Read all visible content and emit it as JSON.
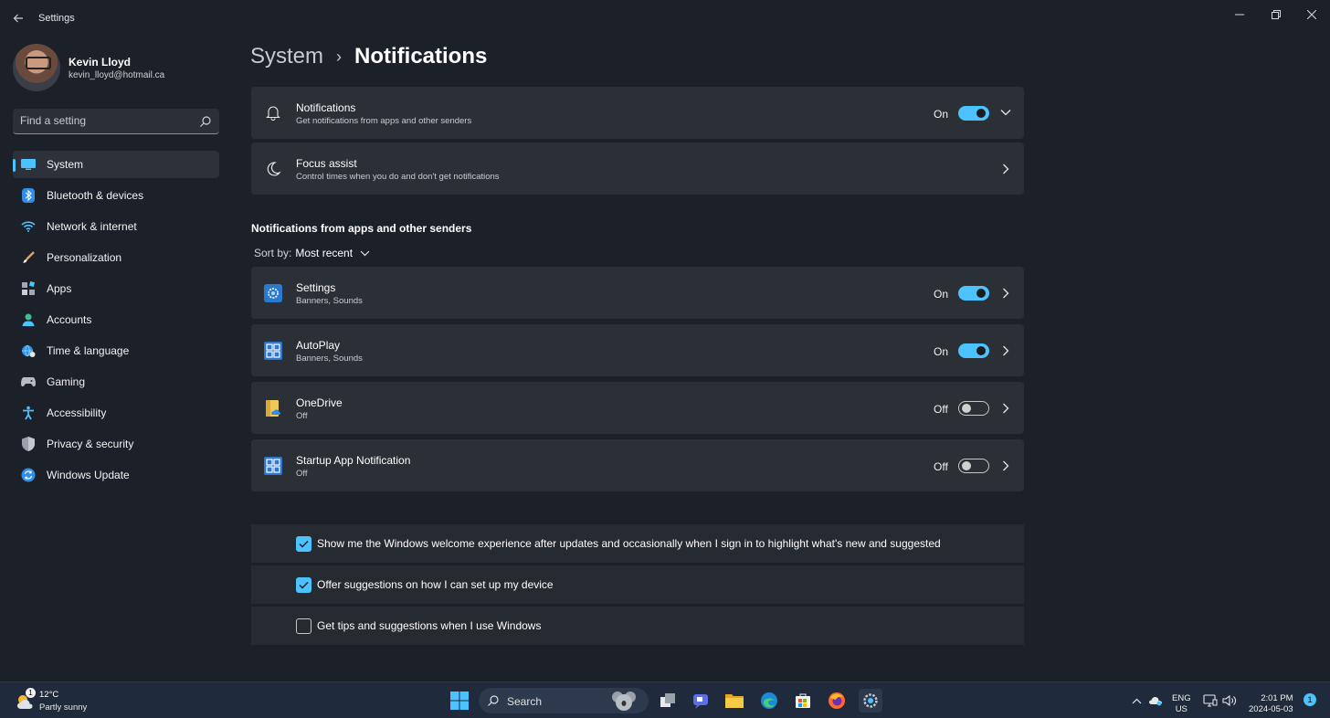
{
  "window": {
    "app_title": "Settings",
    "back_icon": "back-arrow-icon",
    "minimize_icon": "minimize-icon",
    "maximize_icon": "restore-icon",
    "close_icon": "close-icon"
  },
  "profile": {
    "name": "Kevin Lloyd",
    "email": "kevin_lloyd@hotmail.ca"
  },
  "search": {
    "placeholder": "Find a setting",
    "icon": "search-icon"
  },
  "sidebar": {
    "items": [
      {
        "label": "System",
        "icon": "system-icon",
        "active": true
      },
      {
        "label": "Bluetooth & devices",
        "icon": "bluetooth-icon"
      },
      {
        "label": "Network & internet",
        "icon": "wifi-icon"
      },
      {
        "label": "Personalization",
        "icon": "brush-icon"
      },
      {
        "label": "Apps",
        "icon": "apps-icon"
      },
      {
        "label": "Accounts",
        "icon": "accounts-icon"
      },
      {
        "label": "Time & language",
        "icon": "globe-clock-icon"
      },
      {
        "label": "Gaming",
        "icon": "gamepad-icon"
      },
      {
        "label": "Accessibility",
        "icon": "accessibility-icon"
      },
      {
        "label": "Privacy & security",
        "icon": "shield-icon"
      },
      {
        "label": "Windows Update",
        "icon": "update-icon"
      }
    ]
  },
  "main": {
    "breadcrumb_parent": "System",
    "breadcrumb_current": "Notifications",
    "notifications": {
      "title": "Notifications",
      "subtitle": "Get notifications from apps and other senders",
      "state": "On",
      "enabled": true
    },
    "focus_assist": {
      "title": "Focus assist",
      "subtitle": "Control times when you do and don't get notifications"
    },
    "section_title": "Notifications from apps and other senders",
    "sort_label": "Sort by:",
    "sort_value": "Most recent",
    "apps": [
      {
        "name": "Settings",
        "detail": "Banners, Sounds",
        "state": "On",
        "enabled": true,
        "icon": "settings-gear-app-icon"
      },
      {
        "name": "AutoPlay",
        "detail": "Banners, Sounds",
        "state": "On",
        "enabled": true,
        "icon": "autoplay-app-icon"
      },
      {
        "name": "OneDrive",
        "detail": "Off",
        "state": "Off",
        "enabled": false,
        "icon": "onedrive-app-icon"
      },
      {
        "name": "Startup App Notification",
        "detail": "Off",
        "state": "Off",
        "enabled": false,
        "icon": "startup-app-icon"
      }
    ],
    "checks": [
      {
        "label": "Show me the Windows welcome experience after updates and occasionally when I sign in to highlight what's new and suggested",
        "checked": true
      },
      {
        "label": "Offer suggestions on how I can set up my device",
        "checked": true
      },
      {
        "label": "Get tips and suggestions when I use Windows",
        "checked": false
      }
    ]
  },
  "taskbar": {
    "weather_temp": "12°C",
    "weather_cond": "Partly sunny",
    "weather_badge": "1",
    "search_label": "Search",
    "lang_top": "ENG",
    "lang_bottom": "US",
    "time": "2:01 PM",
    "date": "2024-05-03",
    "notification_count": "1"
  },
  "colors": {
    "accent": "#4cc2ff",
    "background": "#1c2129",
    "card": "#2b2f36"
  }
}
